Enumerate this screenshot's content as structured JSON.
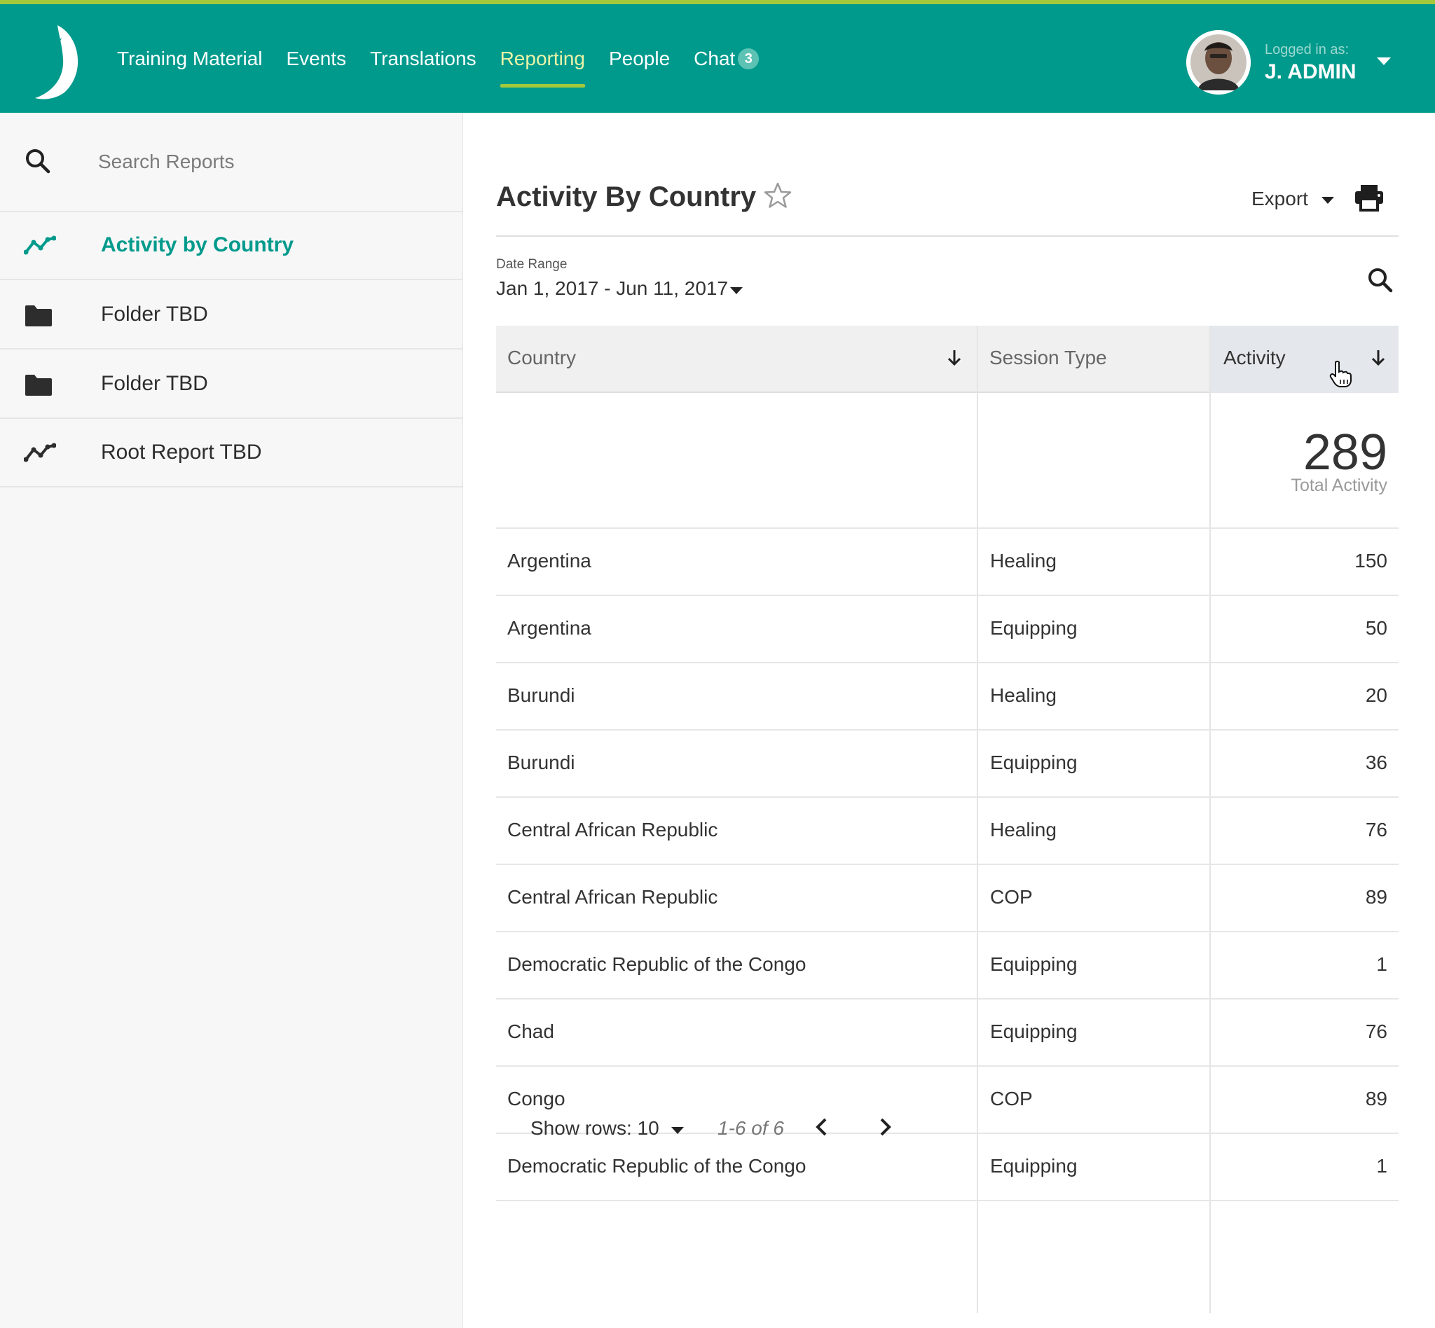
{
  "colors": {
    "header": "#009a8c",
    "accent_bar": "#a3c93a",
    "active_text": "#009a8c"
  },
  "nav": {
    "items": [
      {
        "label": "Training Material"
      },
      {
        "label": "Events"
      },
      {
        "label": "Translations"
      },
      {
        "label": "Reporting",
        "active": true
      },
      {
        "label": "People"
      },
      {
        "label": "Chat",
        "badge": "3"
      }
    ]
  },
  "user": {
    "label": "Logged in as:",
    "name": "J. ADMIN"
  },
  "sidebar": {
    "search_placeholder": "Search Reports",
    "items": [
      {
        "label": "Activity by Country",
        "icon": "chart-line-icon",
        "active": true
      },
      {
        "label": "Folder TBD",
        "icon": "folder-icon"
      },
      {
        "label": "Folder TBD",
        "icon": "folder-icon"
      },
      {
        "label": "Root Report TBD",
        "icon": "chart-line-icon"
      }
    ]
  },
  "report": {
    "title": "Activity By Country",
    "export_label": "Export",
    "date_range_label": "Date Range",
    "date_range_value": "Jan 1, 2017 - Jun 11, 2017"
  },
  "table": {
    "headers": [
      "Country",
      "Session Type",
      "Activity"
    ],
    "total_value": "289",
    "total_label": "Total Activity",
    "rows": [
      [
        "Argentina",
        "Healing",
        "150"
      ],
      [
        "Argentina",
        "Equipping",
        "50"
      ],
      [
        "Burundi",
        "Healing",
        "20"
      ],
      [
        "Burundi",
        "Equipping",
        "36"
      ],
      [
        "Central African Republic",
        "Healing",
        "76"
      ],
      [
        "Central African Republic",
        "COP",
        "89"
      ],
      [
        "Democratic Republic of the Congo",
        "Equipping",
        "1"
      ],
      [
        "Chad",
        "Equipping",
        "76"
      ],
      [
        "Congo",
        "COP",
        "89"
      ],
      [
        "Democratic Republic of the Congo",
        "Equipping",
        "1"
      ]
    ]
  },
  "pager": {
    "show_rows_label": "Show rows:",
    "rows_value": "10",
    "range": "1-6 of 6"
  }
}
